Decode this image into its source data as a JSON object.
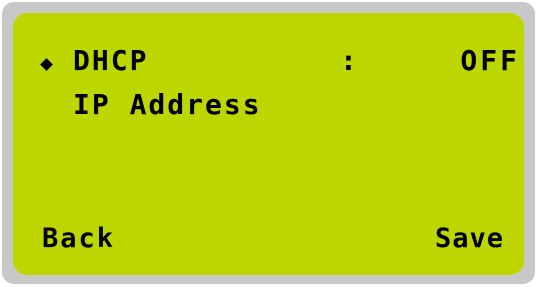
{
  "menu": {
    "cursor_icon": "diamond-cursor-icon",
    "items": [
      {
        "label": "DHCP",
        "separator": ":",
        "value": "OFF"
      },
      {
        "label": "IP Address"
      }
    ]
  },
  "softkeys": {
    "left": "Back",
    "right": "Save"
  },
  "colors": {
    "lcd_background": "#bdd600",
    "bezel": "#c8c8c8",
    "text": "#000000"
  }
}
